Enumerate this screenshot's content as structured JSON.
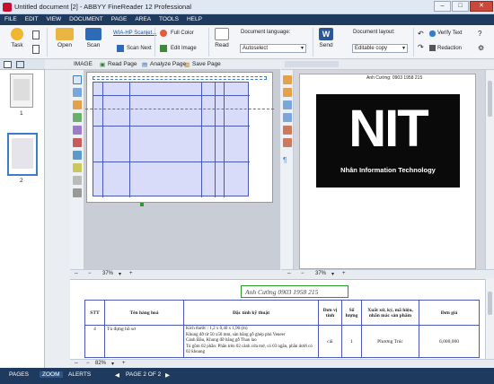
{
  "window": {
    "title": "Untitled document [2] - ABBYY FineReader 12 Professional",
    "minimize": "–",
    "maximize": "□",
    "close": "✕"
  },
  "menu": [
    "FILE",
    "EDIT",
    "VIEW",
    "DOCUMENT",
    "PAGE",
    "AREA",
    "TOOLS",
    "HELP"
  ],
  "toolbar": {
    "task": "Task",
    "open": "Open",
    "scan": "Scan",
    "scanner": "WIA-HP Scanjet...",
    "scan_next": "Scan Next",
    "full_color": "Full Color",
    "edit_image": "Edit Image",
    "read": "Read",
    "doc_lang_label": "Document language:",
    "doc_lang_value": "Autoselect",
    "send": "Send",
    "doc_layout_label": "Document layout:",
    "doc_layout_value": "Editable copy",
    "verify_text": "Verify Text",
    "redaction": "Redaction"
  },
  "image_pane": {
    "title": "IMAGE",
    "read_page": "Read Page",
    "analyze_page": "Analyze Page",
    "save_page": "Save Page",
    "zoom": "37%"
  },
  "text_pane": {
    "zoom": "37%",
    "logo_big": "NIT",
    "logo_sub": "Nhân Information Technology",
    "small_text": "Anh Cường: 0903 1958 215"
  },
  "thumbnails": [
    {
      "num": "1"
    },
    {
      "num": "2"
    }
  ],
  "zoom_pane": {
    "zoom": "82%",
    "handwriting": "Anh Cường  0903 1958 215",
    "headers": [
      "STT",
      "Tên hàng hoá",
      "Đặc tính kỹ thuật",
      "Đơn vị tính",
      "Số lượng",
      "Xuất xứ, ký, mã hiệu, nhãn mác sản phẩm",
      "Đơn giá"
    ],
    "row": {
      "stt": "4",
      "name": "Tủ đựng hồ sơ",
      "spec": "Kích thước : 1,2 x 0,40 x 1,90 (m)\nKhung đỡ từ 50 x50 mm, sàn bằng gỗ ghép phủ Veneer\nCánh Đầu, Khung đỡ bằng gỗ Thao lao\nTủ gồm 02 phần: Phần trên 02 cánh cửa mở, có 03 ngăn, phần dưới có 02 khoang",
      "unit": "cái",
      "qty": "1",
      "origin": "Phương Trúc",
      "price": "6,000,000"
    }
  },
  "statusbar": {
    "pages": "PAGES",
    "zoom": "ZOOM",
    "alerts": "ALERTS",
    "page_info": "PAGE 2 OF 2"
  }
}
